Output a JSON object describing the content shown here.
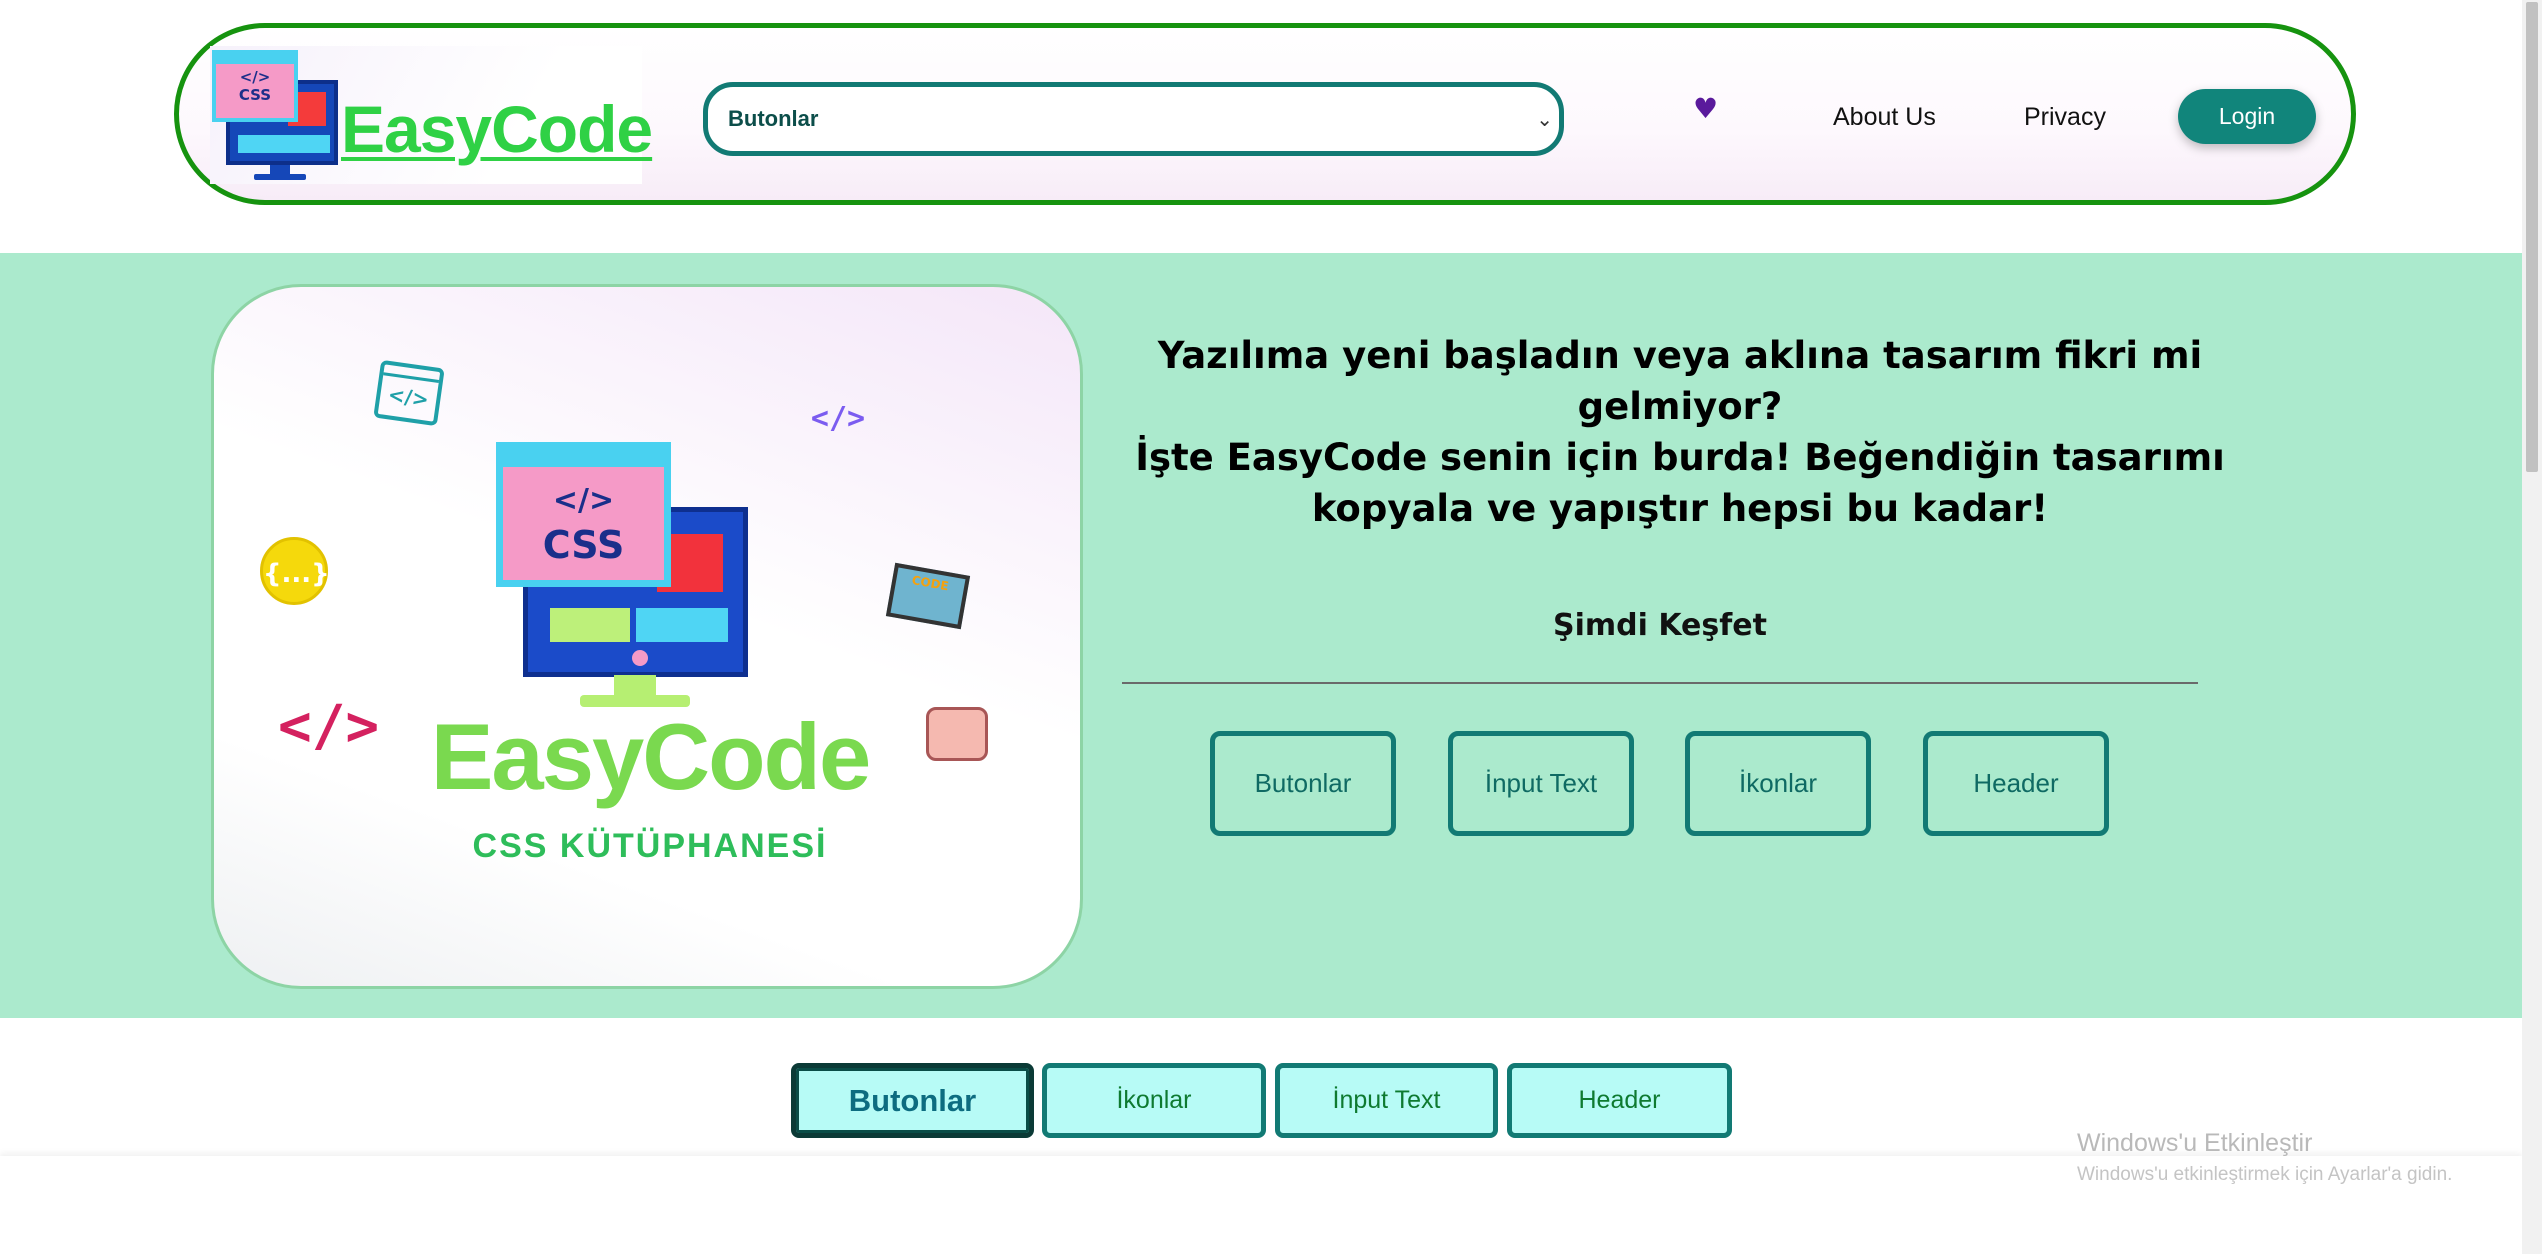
{
  "header": {
    "logo_text": "EasyCode",
    "logo_window_code": "</>",
    "logo_window_css": "CSS",
    "select_value": "Butonlar",
    "select_chevron": "⌄",
    "heart_icon": "♥",
    "nav": [
      {
        "label": "About Us"
      },
      {
        "label": "Privacy"
      }
    ],
    "login_label": "Login"
  },
  "hero": {
    "card": {
      "window_code": "</>",
      "window_css": "CSS",
      "title": "EasyCode",
      "subtitle": "CSS KÜTÜPHANESİ",
      "deco_browser": "</>",
      "deco_chip": "</>",
      "deco_bubble": "{...}",
      "deco_tag": "</>",
      "deco_laptop": "CODE"
    },
    "text_lines": [
      "Yazılıma yeni başladın veya aklına tasarım fikri mi gelmiyor?",
      "İşte EasyCode senin için burda! Beğendiğin tasarımı",
      "kopyala ve yapıştır hepsi bu kadar!"
    ],
    "discover_label": "Şimdi Keşfet",
    "buttons": [
      {
        "label": "Butonlar"
      },
      {
        "label": "İnput Text"
      },
      {
        "label": "İkonlar"
      },
      {
        "label": "Header"
      }
    ]
  },
  "tabs": [
    {
      "label": "Butonlar",
      "active": true
    },
    {
      "label": "İkonlar",
      "active": false
    },
    {
      "label": "İnput Text",
      "active": false
    },
    {
      "label": "Header",
      "active": false
    }
  ],
  "watermark": {
    "title": "Windows'u Etkinleştir",
    "subtitle": "Windows'u etkinleştirmek için Ayarlar'a gidin."
  },
  "colors": {
    "header_border": "#16930f",
    "accent_teal": "#11857b",
    "hero_background": "#abeacd",
    "tab_background": "#b7fbf6",
    "logo_green": "#2fd145"
  }
}
